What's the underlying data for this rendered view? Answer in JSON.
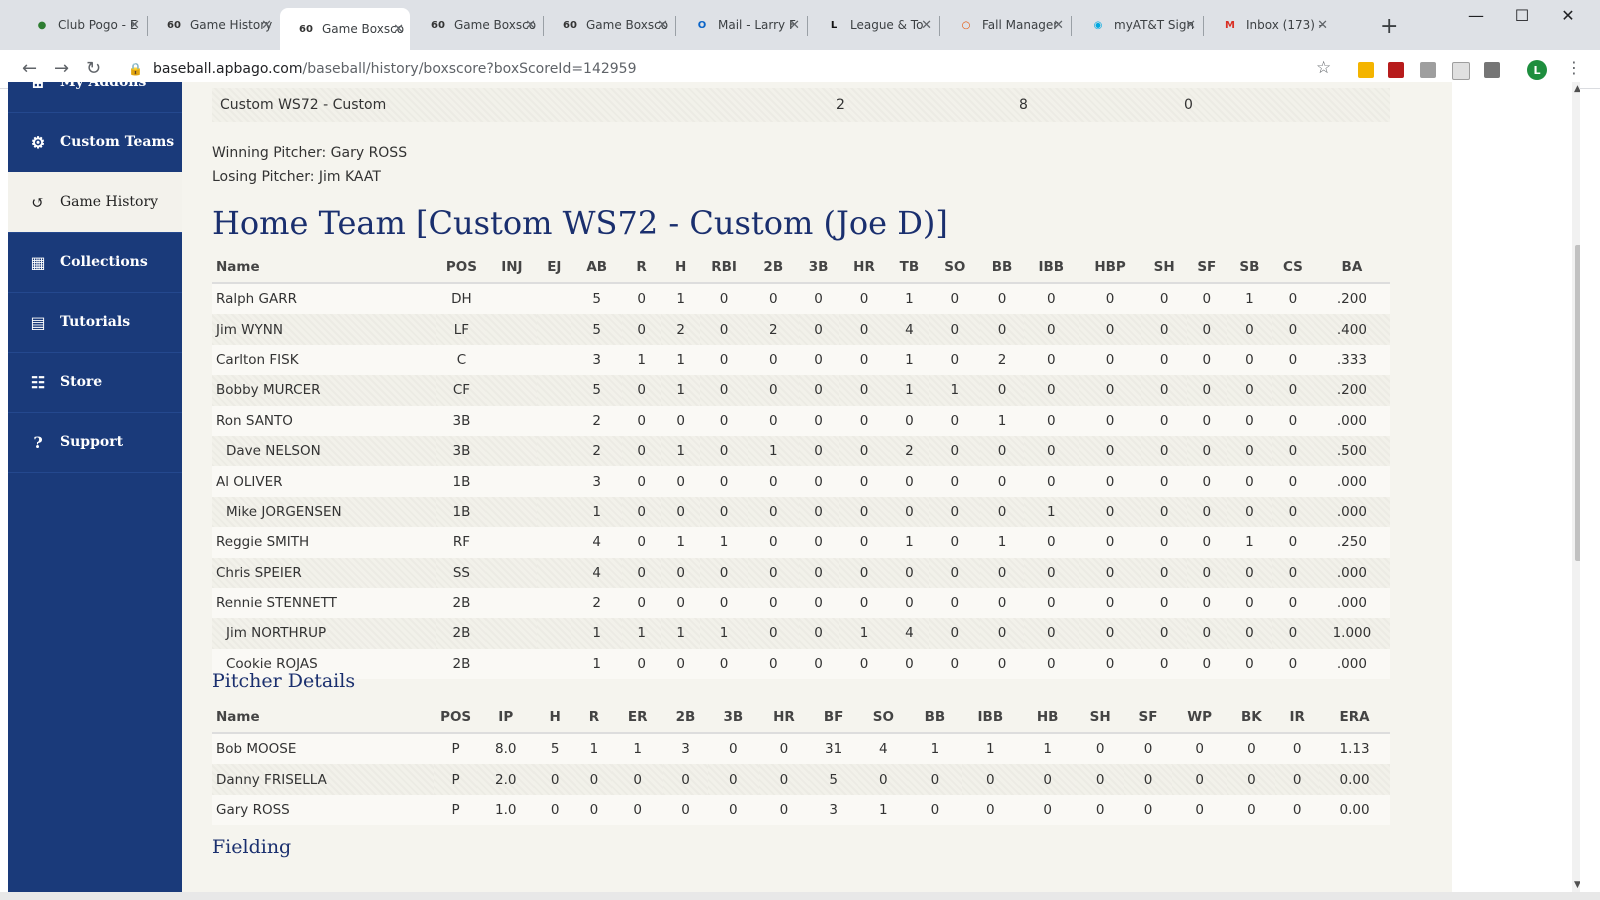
{
  "browser": {
    "tabs": [
      {
        "title": "Club Pogo - E",
        "icon": "pogo-icon",
        "color": "#2e7d32"
      },
      {
        "title": "Game History",
        "icon": "apba-60-icon",
        "color": "#333333"
      },
      {
        "title": "Game Boxsco",
        "icon": "apba-60-icon",
        "color": "#333333",
        "active": true
      },
      {
        "title": "Game Boxsco",
        "icon": "apba-60-icon",
        "color": "#333333"
      },
      {
        "title": "Game Boxsco",
        "icon": "apba-60-icon",
        "color": "#333333"
      },
      {
        "title": "Mail - Larry F",
        "icon": "outlook-icon",
        "color": "#0a64c8"
      },
      {
        "title": "League & To",
        "icon": "league-icon",
        "color": "#111111"
      },
      {
        "title": "Fall Manager",
        "icon": "fall-manager-icon",
        "color": "#e65100"
      },
      {
        "title": "myAT&T Sign",
        "icon": "att-icon",
        "color": "#00a8e0"
      },
      {
        "title": "Inbox (173) -",
        "icon": "gmail-icon",
        "color": "#d93025"
      }
    ],
    "url_host": "baseball.apbago.com",
    "url_path": "/baseball/history/boxscore?boxScoreId=142959",
    "profile_initial": "L"
  },
  "sidebar": {
    "items": [
      {
        "label": "My Addons",
        "icon": "addons-icon"
      },
      {
        "label": "Custom Teams",
        "icon": "gear-icon"
      },
      {
        "label": "Game History",
        "icon": "history-icon",
        "active": true
      },
      {
        "label": "Collections",
        "icon": "database-icon"
      },
      {
        "label": "Tutorials",
        "icon": "book-icon"
      },
      {
        "label": "Store",
        "icon": "cart-icon"
      },
      {
        "label": "Support",
        "icon": "help-icon"
      }
    ]
  },
  "linescore_row": {
    "team": "Custom WS72 - Custom",
    "r": "2",
    "h": "8",
    "e": "0"
  },
  "winning_pitcher": "Winning Pitcher: Gary ROSS",
  "losing_pitcher": "Losing Pitcher: Jim KAAT",
  "home_title": "Home Team [Custom WS72 - Custom (Joe D)]",
  "batting": {
    "headers": [
      "Name",
      "POS",
      "INJ",
      "EJ",
      "AB",
      "R",
      "H",
      "RBI",
      "2B",
      "3B",
      "HR",
      "TB",
      "SO",
      "BB",
      "IBB",
      "HBP",
      "SH",
      "SF",
      "SB",
      "CS",
      "BA"
    ],
    "rows": [
      {
        "sub": false,
        "cells": [
          "Ralph GARR",
          "DH",
          "",
          "",
          "5",
          "0",
          "1",
          "0",
          "0",
          "0",
          "0",
          "1",
          "0",
          "0",
          "0",
          "0",
          "0",
          "0",
          "1",
          "0",
          ".200"
        ]
      },
      {
        "sub": false,
        "cells": [
          "Jim WYNN",
          "LF",
          "",
          "",
          "5",
          "0",
          "2",
          "0",
          "2",
          "0",
          "0",
          "4",
          "0",
          "0",
          "0",
          "0",
          "0",
          "0",
          "0",
          "0",
          ".400"
        ]
      },
      {
        "sub": false,
        "cells": [
          "Carlton FISK",
          "C",
          "",
          "",
          "3",
          "1",
          "1",
          "0",
          "0",
          "0",
          "0",
          "1",
          "0",
          "2",
          "0",
          "0",
          "0",
          "0",
          "0",
          "0",
          ".333"
        ]
      },
      {
        "sub": false,
        "cells": [
          "Bobby MURCER",
          "CF",
          "",
          "",
          "5",
          "0",
          "1",
          "0",
          "0",
          "0",
          "0",
          "1",
          "1",
          "0",
          "0",
          "0",
          "0",
          "0",
          "0",
          "0",
          ".200"
        ]
      },
      {
        "sub": false,
        "cells": [
          "Ron SANTO",
          "3B",
          "",
          "",
          "2",
          "0",
          "0",
          "0",
          "0",
          "0",
          "0",
          "0",
          "0",
          "1",
          "0",
          "0",
          "0",
          "0",
          "0",
          "0",
          ".000"
        ]
      },
      {
        "sub": true,
        "cells": [
          "Dave NELSON",
          "3B",
          "",
          "",
          "2",
          "0",
          "1",
          "0",
          "1",
          "0",
          "0",
          "2",
          "0",
          "0",
          "0",
          "0",
          "0",
          "0",
          "0",
          "0",
          ".500"
        ]
      },
      {
        "sub": false,
        "cells": [
          "Al OLIVER",
          "1B",
          "",
          "",
          "3",
          "0",
          "0",
          "0",
          "0",
          "0",
          "0",
          "0",
          "0",
          "0",
          "0",
          "0",
          "0",
          "0",
          "0",
          "0",
          ".000"
        ]
      },
      {
        "sub": true,
        "cells": [
          "Mike JORGENSEN",
          "1B",
          "",
          "",
          "1",
          "0",
          "0",
          "0",
          "0",
          "0",
          "0",
          "0",
          "0",
          "0",
          "1",
          "0",
          "0",
          "0",
          "0",
          "0",
          ".000"
        ]
      },
      {
        "sub": false,
        "cells": [
          "Reggie SMITH",
          "RF",
          "",
          "",
          "4",
          "0",
          "1",
          "1",
          "0",
          "0",
          "0",
          "1",
          "0",
          "1",
          "0",
          "0",
          "0",
          "0",
          "1",
          "0",
          ".250"
        ]
      },
      {
        "sub": false,
        "cells": [
          "Chris SPEIER",
          "SS",
          "",
          "",
          "4",
          "0",
          "0",
          "0",
          "0",
          "0",
          "0",
          "0",
          "0",
          "0",
          "0",
          "0",
          "0",
          "0",
          "0",
          "0",
          ".000"
        ]
      },
      {
        "sub": false,
        "cells": [
          "Rennie STENNETT",
          "2B",
          "",
          "",
          "2",
          "0",
          "0",
          "0",
          "0",
          "0",
          "0",
          "0",
          "0",
          "0",
          "0",
          "0",
          "0",
          "0",
          "0",
          "0",
          ".000"
        ]
      },
      {
        "sub": true,
        "cells": [
          "Jim NORTHRUP",
          "2B",
          "",
          "",
          "1",
          "1",
          "1",
          "1",
          "0",
          "0",
          "1",
          "4",
          "0",
          "0",
          "0",
          "0",
          "0",
          "0",
          "0",
          "0",
          "1.000"
        ]
      },
      {
        "sub": true,
        "cells": [
          "Cookie ROJAS",
          "2B",
          "",
          "",
          "1",
          "0",
          "0",
          "0",
          "0",
          "0",
          "0",
          "0",
          "0",
          "0",
          "0",
          "0",
          "0",
          "0",
          "0",
          "0",
          ".000"
        ]
      }
    ]
  },
  "pitcher_title": "Pitcher Details",
  "pitching": {
    "headers": [
      "Name",
      "POS",
      "IP",
      "H",
      "R",
      "ER",
      "2B",
      "3B",
      "HR",
      "BF",
      "SO",
      "BB",
      "IBB",
      "HB",
      "SH",
      "SF",
      "WP",
      "BK",
      "IR",
      "ERA"
    ],
    "rows": [
      {
        "cells": [
          "Bob MOOSE",
          "P",
          "8.0",
          "5",
          "1",
          "1",
          "3",
          "0",
          "0",
          "31",
          "4",
          "1",
          "1",
          "1",
          "0",
          "0",
          "0",
          "0",
          "0",
          "1.13"
        ]
      },
      {
        "cells": [
          "Danny FRISELLA",
          "P",
          "2.0",
          "0",
          "0",
          "0",
          "0",
          "0",
          "0",
          "5",
          "0",
          "0",
          "0",
          "0",
          "0",
          "0",
          "0",
          "0",
          "0",
          "0.00"
        ]
      },
      {
        "cells": [
          "Gary ROSS",
          "P",
          "1.0",
          "0",
          "0",
          "0",
          "0",
          "0",
          "0",
          "3",
          "1",
          "0",
          "0",
          "0",
          "0",
          "0",
          "0",
          "0",
          "0",
          "0.00"
        ]
      }
    ]
  },
  "fielding_title": "Fielding"
}
